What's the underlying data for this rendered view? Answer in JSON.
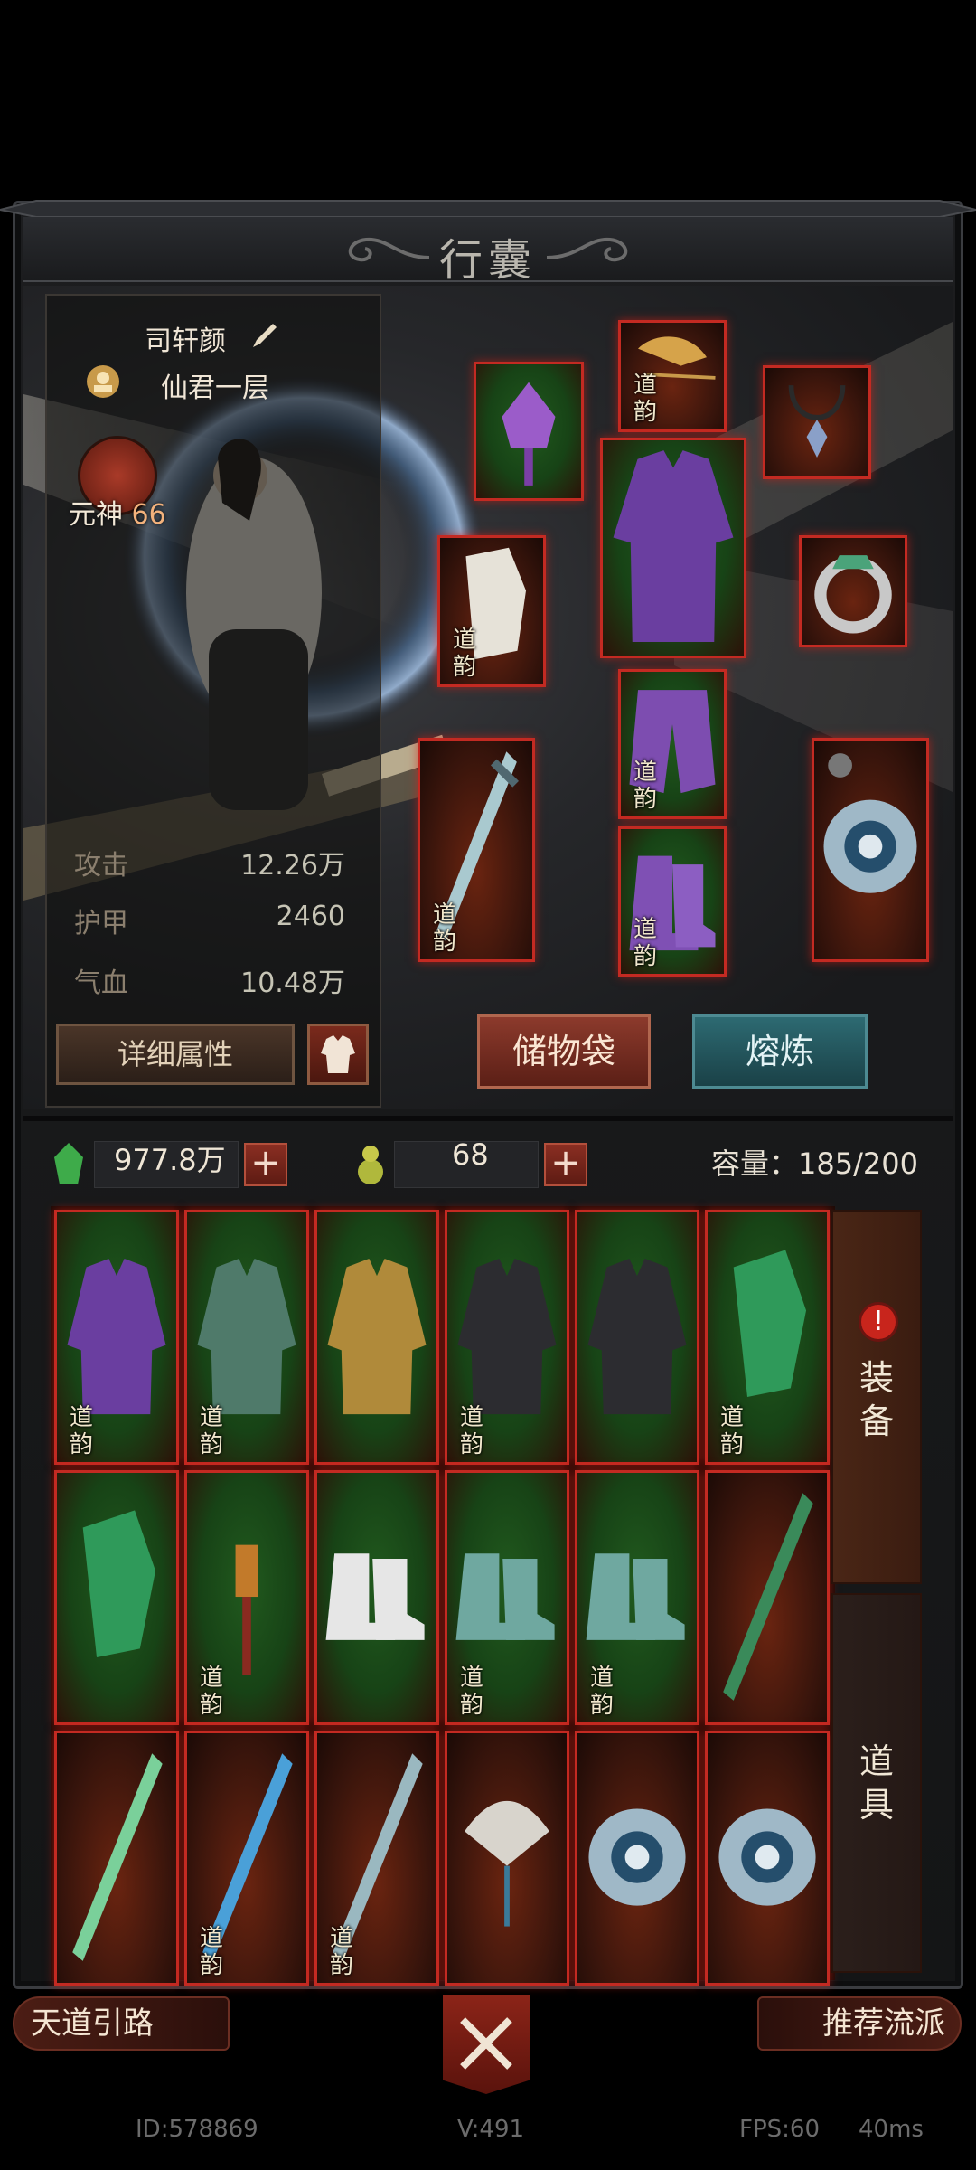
{
  "title": "行囊",
  "character": {
    "name": "司轩颜",
    "rank": "仙君一层",
    "spirit_label": "元神",
    "spirit_value": "66",
    "stats": [
      {
        "label": "攻击",
        "value": "12.26万"
      },
      {
        "label": "护甲",
        "value": "2460"
      },
      {
        "label": "气血",
        "value": "10.48万"
      }
    ],
    "detail_button": "详细属性"
  },
  "actions": {
    "bag_button": "储物袋",
    "smelt_button": "熔炼"
  },
  "currency": {
    "jade_amount": "977.8万",
    "gourd_amount": "68",
    "plus": "+",
    "capacity": "容量：185/200"
  },
  "equipped": {
    "tag": "道\n韵"
  },
  "tabs": {
    "equipment": "装\n备",
    "items": "道\n具",
    "alert": "!"
  },
  "grid_tag": "道韵",
  "bottom": {
    "left_button": "天道引路",
    "right_button": "推荐流派"
  },
  "footer": {
    "id": "ID:578869",
    "version": "V:491",
    "fps": "FPS:60",
    "latency": "40ms"
  },
  "colors": {
    "slot_border": "#c32a22",
    "green_slot": "#215a1e",
    "red_slot": "#3a150c",
    "smelt_button": "#2d6a72",
    "bag_button": "#8c3a2c"
  }
}
